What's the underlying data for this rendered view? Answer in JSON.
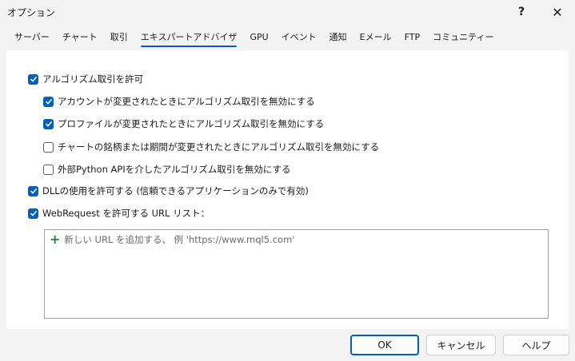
{
  "window": {
    "title": "オプション",
    "help_glyph": "?",
    "close_glyph": "✕"
  },
  "tabs": [
    {
      "label": "サーバー",
      "active": false
    },
    {
      "label": "チャート",
      "active": false
    },
    {
      "label": "取引",
      "active": false
    },
    {
      "label": "エキスパートアドバイザ",
      "active": true
    },
    {
      "label": "GPU",
      "active": false
    },
    {
      "label": "イベント",
      "active": false
    },
    {
      "label": "通知",
      "active": false
    },
    {
      "label": "Eメール",
      "active": false
    },
    {
      "label": "FTP",
      "active": false
    },
    {
      "label": "コミュニティー",
      "active": false
    }
  ],
  "options": {
    "allow_algo_trading": {
      "label": "アルゴリズム取引を許可",
      "checked": true
    },
    "disable_on_account_change": {
      "label": "アカウントが変更されたときにアルゴリズム取引を無効にする",
      "checked": true
    },
    "disable_on_profile_change": {
      "label": "プロファイルが変更されたときにアルゴリズム取引を無効にする",
      "checked": true
    },
    "disable_on_symbol_change": {
      "label": "チャートの銘柄または期間が変更されたときにアルゴリズム取引を無効にする",
      "checked": false
    },
    "disable_external_python": {
      "label": "外部Python APIを介したアルゴリズム取引を無効にする",
      "checked": false
    },
    "allow_dll": {
      "label": "DLLの使用を許可する (信頼できるアプリケーションのみで有効)",
      "checked": true
    },
    "allow_webrequest": {
      "label": "WebRequest を許可する URL リスト：",
      "checked": true
    }
  },
  "url_list": {
    "add_placeholder": "新しい URL を追加する、 例 'https://www.mql5.com'",
    "add_icon": "plus-icon"
  },
  "buttons": {
    "ok": "OK",
    "cancel": "キャンセル",
    "help": "ヘルプ"
  },
  "colors": {
    "accent": "#005fb8",
    "plus": "#2e8b3a"
  }
}
